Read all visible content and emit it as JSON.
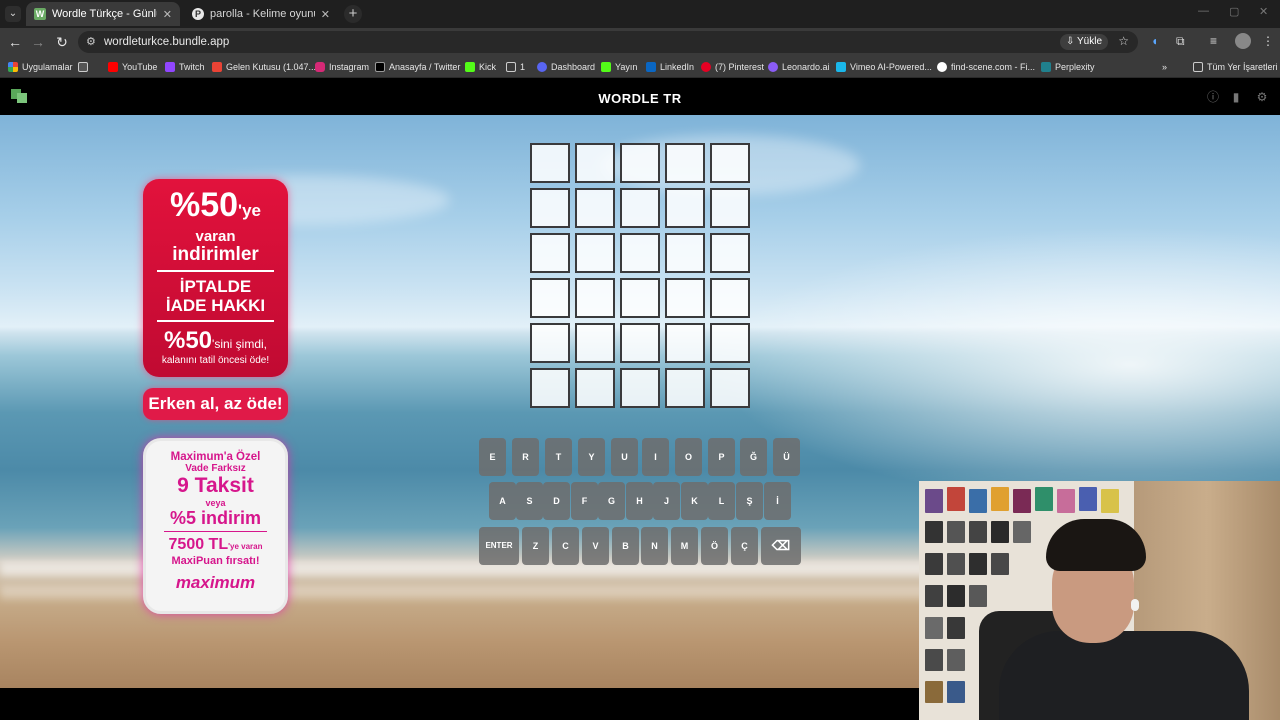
{
  "browser": {
    "tabs": [
      {
        "title": "Wordle Türkçe - Günlük Kelime",
        "favicon": "W",
        "active": true
      },
      {
        "title": "parolla - Kelime oyunu. Günlük",
        "favicon": "P",
        "active": false
      }
    ],
    "url": "wordleturkce.bundle.app",
    "install_label": "Yükle",
    "bookmarks": [
      {
        "label": "Uygulamalar",
        "color": "#e8a33b"
      },
      {
        "label": "",
        "color": "#cccccc"
      },
      {
        "label": "YouTube",
        "color": "#ff0000"
      },
      {
        "label": "Twitch",
        "color": "#9146ff"
      },
      {
        "label": "Gelen Kutusu (1.047...",
        "color": "#ea4335"
      },
      {
        "label": "Instagram",
        "color": "#d62976"
      },
      {
        "label": "Anasayfa / Twitter",
        "color": "#000000"
      },
      {
        "label": "Kick",
        "color": "#53fc18"
      },
      {
        "label": "1",
        "color": "#bbbbbb"
      },
      {
        "label": "Dashboard",
        "color": "#5865f2"
      },
      {
        "label": "Yayın",
        "color": "#53fc18"
      },
      {
        "label": "LinkedIn",
        "color": "#0a66c2"
      },
      {
        "label": "(7) Pinterest",
        "color": "#e60023"
      },
      {
        "label": "Leonardo.ai",
        "color": "#8b5cf6"
      },
      {
        "label": "Vimeo AI-Powered...",
        "color": "#1ab7ea"
      },
      {
        "label": "find-scene.com - Fi...",
        "color": "#ffffff"
      },
      {
        "label": "Perplexity",
        "color": "#20808d"
      }
    ],
    "all_bookmarks_label": "Tüm Yer İşaretleri"
  },
  "app": {
    "title": "WORDLE TR",
    "icons": [
      "info-icon",
      "stats-icon",
      "settings-icon"
    ]
  },
  "board": {
    "rows": 6,
    "cols": 5
  },
  "keyboard": {
    "row1": [
      "E",
      "R",
      "T",
      "Y",
      "U",
      "I",
      "O",
      "P",
      "Ğ",
      "Ü"
    ],
    "row2": [
      "A",
      "S",
      "D",
      "F",
      "G",
      "H",
      "J",
      "K",
      "L",
      "Ş",
      "İ"
    ],
    "row3": [
      "ENTER",
      "Z",
      "C",
      "V",
      "B",
      "N",
      "M",
      "Ö",
      "Ç",
      "⌫"
    ]
  },
  "ad": {
    "top_big": "%50",
    "top_big_suffix": "'ye",
    "top_l1": "varan",
    "top_l2": "indirimler",
    "top_l3": "İPTALDE",
    "top_l4": "İADE HAKKI",
    "top_pct": "%50",
    "top_pct_suffix": "'sini şimdi,",
    "top_small": "kalanını tatil öncesi öde!",
    "pill": "Erken al, az öde!",
    "b1": "Maximum'a Özel",
    "b1b": "Vade Farksız",
    "b2": "9 Taksit",
    "b3": "veya",
    "b4": "%5 indirim",
    "b5": "7500 TL",
    "b5_suffix": "'ye varan",
    "b6": "MaxiPuan fırsatı!",
    "logo": "maximum",
    "colors": {
      "red": "#d91039",
      "pink": "#d6168c"
    }
  }
}
